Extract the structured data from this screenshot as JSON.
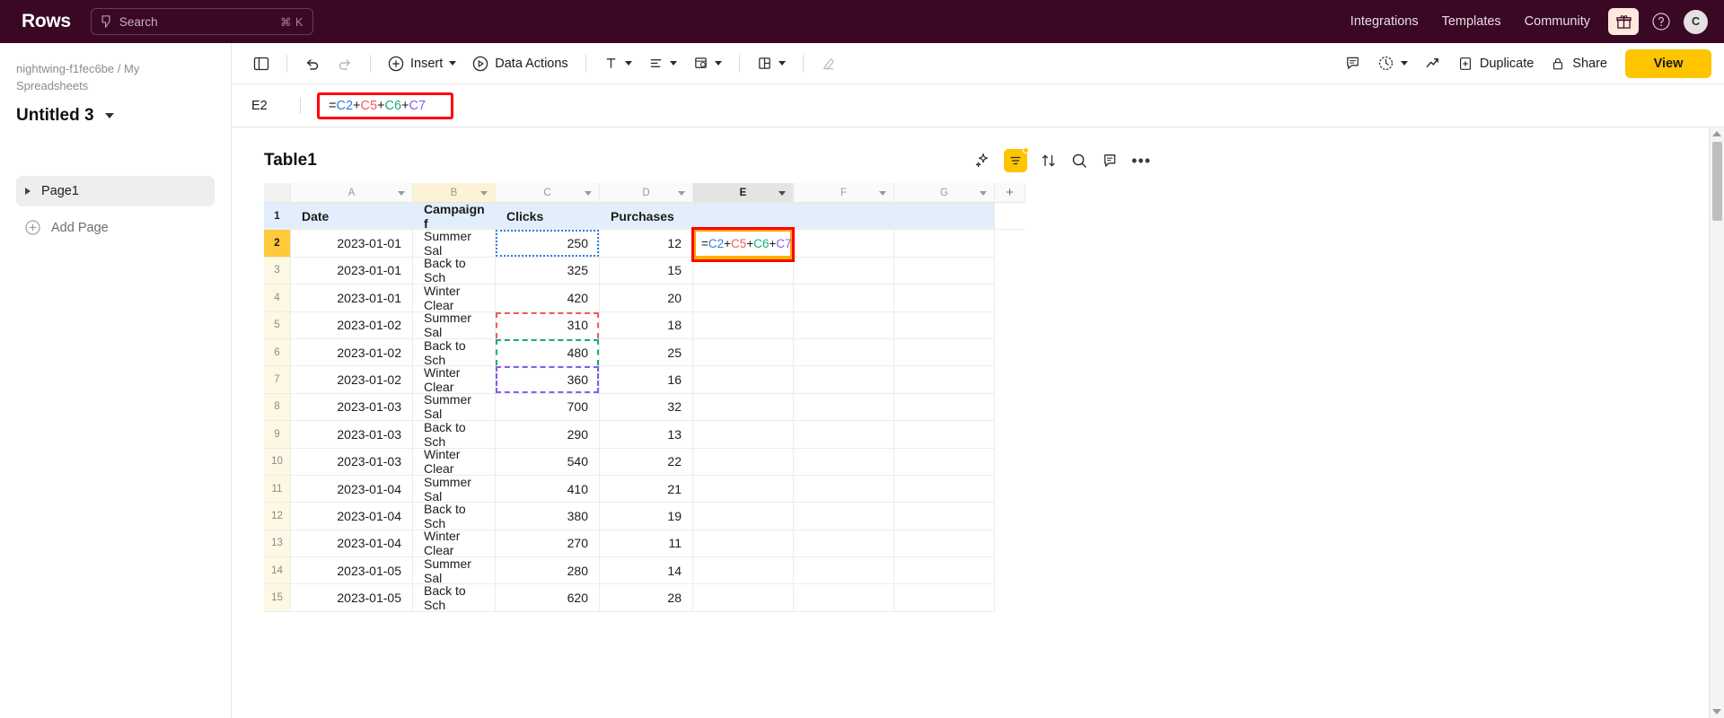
{
  "topbar": {
    "brand": "Rows",
    "search": {
      "placeholder": "Search",
      "shortcut": "⌘ K",
      "icon": "bolt-icon"
    },
    "links": [
      {
        "label": "Integrations"
      },
      {
        "label": "Templates"
      },
      {
        "label": "Community"
      }
    ],
    "gift_icon": "gift-icon",
    "help_icon": "help-circle-icon",
    "avatar_initial": "C"
  },
  "sidebar": {
    "breadcrumb": "nightwing-f1fec6be / My Spreadsheets",
    "doc_title": "Untitled 3",
    "pages": [
      {
        "label": "Page1"
      }
    ],
    "add_page_label": "Add Page"
  },
  "toolbar": {
    "panel_label": "",
    "undo_label": "",
    "redo_label": "",
    "insert_label": "Insert",
    "data_actions_label": "Data Actions",
    "duplicate_label": "Duplicate",
    "share_label": "Share",
    "view_label": "View"
  },
  "formula_bar": {
    "cell_ref": "E2",
    "tokens": [
      {
        "text": "=",
        "color": "plain"
      },
      {
        "text": "C2",
        "color": "blue"
      },
      {
        "text": "+",
        "color": "plain"
      },
      {
        "text": "C5",
        "color": "red"
      },
      {
        "text": "+",
        "color": "plain"
      },
      {
        "text": "C6",
        "color": "green"
      },
      {
        "text": "+",
        "color": "plain"
      },
      {
        "text": "C7",
        "color": "purple"
      }
    ],
    "formula_text": "=C2+C5+C6+C7"
  },
  "table": {
    "name": "Table1",
    "tools": [
      "ai-sparkle-icon",
      "filter-icon",
      "sort-icon",
      "search-icon",
      "comment-icon",
      "more-icon"
    ],
    "columns": [
      {
        "letter": "A",
        "highlight": "none"
      },
      {
        "letter": "B",
        "highlight": "yellow"
      },
      {
        "letter": "C",
        "highlight": "none"
      },
      {
        "letter": "D",
        "highlight": "none"
      },
      {
        "letter": "E",
        "highlight": "selected"
      },
      {
        "letter": "F",
        "highlight": "none"
      },
      {
        "letter": "G",
        "highlight": "none"
      }
    ],
    "add_column_label": "+",
    "header_row": {
      "number": "1",
      "cells": [
        "Date",
        "Campaign f",
        "Clicks",
        "Purchases",
        "",
        "",
        ""
      ]
    },
    "rows": [
      {
        "n": "2",
        "date": "2023-01-01",
        "campaign": "Summer Sal",
        "clicks": "250",
        "purchases": "12",
        "e": "",
        "trace": "blue",
        "editing": true
      },
      {
        "n": "3",
        "date": "2023-01-01",
        "campaign": "Back to Sch",
        "clicks": "325",
        "purchases": "15",
        "e": "",
        "trace": "none",
        "editing": false
      },
      {
        "n": "4",
        "date": "2023-01-01",
        "campaign": "Winter Clear",
        "clicks": "420",
        "purchases": "20",
        "e": "",
        "trace": "none",
        "editing": false
      },
      {
        "n": "5",
        "date": "2023-01-02",
        "campaign": "Summer Sal",
        "clicks": "310",
        "purchases": "18",
        "e": "",
        "trace": "red",
        "editing": false
      },
      {
        "n": "6",
        "date": "2023-01-02",
        "campaign": "Back to Sch",
        "clicks": "480",
        "purchases": "25",
        "e": "",
        "trace": "green",
        "editing": false
      },
      {
        "n": "7",
        "date": "2023-01-02",
        "campaign": "Winter Clear",
        "clicks": "360",
        "purchases": "16",
        "e": "",
        "trace": "purple",
        "editing": false
      },
      {
        "n": "8",
        "date": "2023-01-03",
        "campaign": "Summer Sal",
        "clicks": "700",
        "purchases": "32",
        "e": "",
        "trace": "none",
        "editing": false
      },
      {
        "n": "9",
        "date": "2023-01-03",
        "campaign": "Back to Sch",
        "clicks": "290",
        "purchases": "13",
        "e": "",
        "trace": "none",
        "editing": false
      },
      {
        "n": "10",
        "date": "2023-01-03",
        "campaign": "Winter Clear",
        "clicks": "540",
        "purchases": "22",
        "e": "",
        "trace": "none",
        "editing": false
      },
      {
        "n": "11",
        "date": "2023-01-04",
        "campaign": "Summer Sal",
        "clicks": "410",
        "purchases": "21",
        "e": "",
        "trace": "none",
        "editing": false
      },
      {
        "n": "12",
        "date": "2023-01-04",
        "campaign": "Back to Sch",
        "clicks": "380",
        "purchases": "19",
        "e": "",
        "trace": "none",
        "editing": false
      },
      {
        "n": "13",
        "date": "2023-01-04",
        "campaign": "Winter Clear",
        "clicks": "270",
        "purchases": "11",
        "e": "",
        "trace": "none",
        "editing": false
      },
      {
        "n": "14",
        "date": "2023-01-05",
        "campaign": "Summer Sal",
        "clicks": "280",
        "purchases": "14",
        "e": "",
        "trace": "none",
        "editing": false
      },
      {
        "n": "15",
        "date": "2023-01-05",
        "campaign": "Back to Sch",
        "clicks": "620",
        "purchases": "28",
        "e": "",
        "trace": "none",
        "editing": false
      }
    ]
  },
  "colors": {
    "topbar_bg": "#3A0725",
    "accent_yellow": "#FFC400",
    "edit_outline": "#FF0000",
    "ref_blue": "#2f7be4",
    "ref_red": "#f25b5b",
    "ref_green": "#12b07a",
    "ref_purple": "#8a5cf5"
  }
}
